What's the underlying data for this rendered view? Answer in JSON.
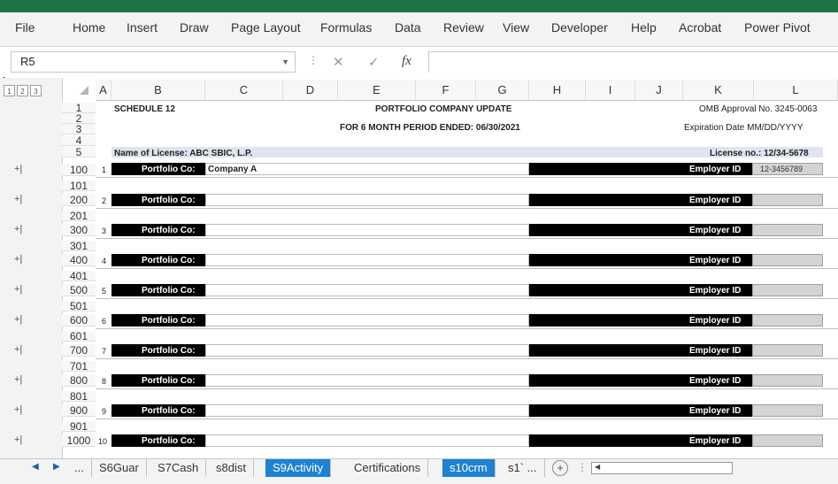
{
  "ribbon": {
    "tabs": [
      "File",
      "Home",
      "Insert",
      "Draw",
      "Page Layout",
      "Formulas",
      "Data",
      "Review",
      "View",
      "Developer",
      "Help",
      "Acrobat",
      "Power Pivot"
    ]
  },
  "formula_bar": {
    "name_box": "R5",
    "fx": "fx"
  },
  "outline": {
    "levels": [
      "1",
      "2",
      "3"
    ]
  },
  "columns": [
    "A",
    "B",
    "C",
    "D",
    "E",
    "F",
    "G",
    "H",
    "I",
    "J",
    "K",
    "L"
  ],
  "rows": [
    "1",
    "2",
    "3",
    "4",
    "5",
    "100",
    "101",
    "200",
    "201",
    "300",
    "301",
    "400",
    "401",
    "500",
    "501",
    "600",
    "601",
    "700",
    "701",
    "800",
    "801",
    "900",
    "901",
    "1000"
  ],
  "header": {
    "schedule": "SCHEDULE 12",
    "title": "PORTFOLIO COMPANY UPDATE",
    "period": "FOR 6 MONTH PERIOD ENDED: 06/30/2021",
    "omb": "OMB Approval No. 3245-0063",
    "expiration": "Expiration Date MM/DD/YYYY",
    "license_name": "Name of License:  ABC SBIC, L.P.",
    "license_no": "License no.: 12/34-5678"
  },
  "entries": [
    {
      "num": "1",
      "label": "Portfolio Co:",
      "company": "Company A",
      "eid_label": "Employer ID",
      "eid": "12-3456789"
    },
    {
      "num": "2",
      "label": "Portfolio Co:",
      "company": "",
      "eid_label": "Employer ID",
      "eid": ""
    },
    {
      "num": "3",
      "label": "Portfolio Co:",
      "company": "",
      "eid_label": "Employer ID",
      "eid": ""
    },
    {
      "num": "4",
      "label": "Portfolio Co:",
      "company": "",
      "eid_label": "Employer ID",
      "eid": ""
    },
    {
      "num": "5",
      "label": "Portfolio Co:",
      "company": "",
      "eid_label": "Employer ID",
      "eid": ""
    },
    {
      "num": "6",
      "label": "Portfolio Co:",
      "company": "",
      "eid_label": "Employer ID",
      "eid": ""
    },
    {
      "num": "7",
      "label": "Portfolio Co:",
      "company": "",
      "eid_label": "Employer ID",
      "eid": ""
    },
    {
      "num": "8",
      "label": "Portfolio Co:",
      "company": "",
      "eid_label": "Employer ID",
      "eid": ""
    },
    {
      "num": "9",
      "label": "Portfolio Co:",
      "company": "",
      "eid_label": "Employer ID",
      "eid": ""
    },
    {
      "num": "10",
      "label": "Portfolio Co:",
      "company": "",
      "eid_label": "Employer ID",
      "eid": ""
    }
  ],
  "sheet_tabs": [
    {
      "label": "...",
      "active": false
    },
    {
      "label": "S6Guar",
      "active": false
    },
    {
      "label": "S7Cash",
      "active": false
    },
    {
      "label": "s8dist",
      "active": false
    },
    {
      "label": "S9Activity",
      "active": true
    },
    {
      "label": "Certifications",
      "active": false
    },
    {
      "label": "s10crm",
      "active": true
    },
    {
      "label": "s1` ...",
      "active": false
    }
  ],
  "colors": {
    "excel_green": "#217346",
    "tab_blue": "#1e82d2",
    "bar_black": "#000000"
  }
}
